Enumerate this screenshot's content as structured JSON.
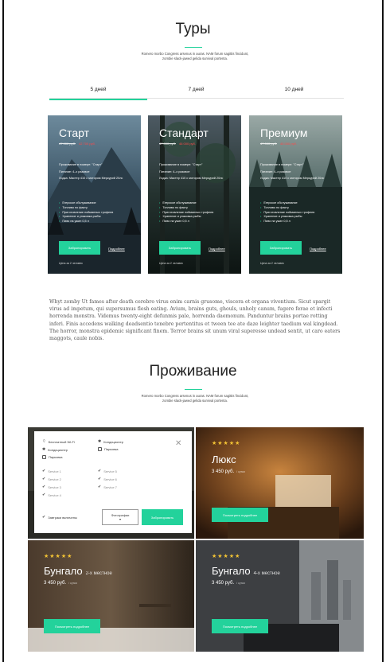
{
  "tours": {
    "title": "Туры",
    "subtitle": "Romero morbo Congress arsenus in auras. NAM forum sagittis fincidunt, zombie slack-jawed gelida survival portenta.",
    "tabs": [
      {
        "label": "5 дней",
        "active": true
      },
      {
        "label": "7 дней",
        "active": false
      },
      {
        "label": "10 дней",
        "active": false
      }
    ],
    "cards": [
      {
        "title": "Старт",
        "old_price": "47 000 руб.",
        "new_price": "42 700 руб.",
        "accommodation": "Проживание в номере: \"Старт\"",
        "food": "Питание: 4–х разовое",
        "boat": "Лодка: Мастер 410 с мотором Меркурий 20лс",
        "features": [
          "Егерское обслуживание",
          "Топливо по факту",
          "Приготовление пойманных трофеев",
          "Хранение и упаковка рыбы",
          "Пиво на ужин 0,5 л"
        ],
        "buy_label": "Забронировать",
        "more_label": "Подробнее",
        "note": "Цена за 2 человек"
      },
      {
        "title": "Стандарт",
        "old_price": "47 000 руб.",
        "new_price": "46 000 руб.",
        "accommodation": "Проживание в номере: \"Старт\"",
        "food": "Питание: 4–х разовое",
        "boat": "Лодка: Мастер 410 с мотором Меркурий 20лс",
        "features": [
          "Егерское обслуживание",
          "Топливо по факту",
          "Приготовление пойманных трофеев",
          "Хранение и упаковка рыбы",
          "Пиво на ужин 0,5 л"
        ],
        "buy_label": "Забронировать",
        "more_label": "Подробнее",
        "note": "Цена за 2 человек"
      },
      {
        "title": "Премиум",
        "old_price": "47 000 руб.",
        "new_price": "45 000 руб.",
        "accommodation": "Проживание в номере: \"Старт\"",
        "food": "Питание: 4–х разовое",
        "boat": "Лодка: Мастер 410 с мотором Меркурий 20лс",
        "features": [
          "Егерское обслуживание",
          "Топливо по факту",
          "Приготовление пойманных трофеев",
          "Хранение и упаковка рыбы",
          "Пиво на ужин 0,5 л"
        ],
        "buy_label": "Забронировать",
        "more_label": "Подробнее",
        "note": "Цена за 2 человек"
      }
    ]
  },
  "paragraph": "Whyt zomby Ut fames after death cerebro virus enim carnis grusome, viscera et organa viventium. Sicut spargit virus ad impetum, qui supersumus flesh eating. Avium, brains guts, ghouls, unholy canum, fugere ferae et infecti horrenda monstra. Videmus twenty-eight defunmis pale, horrenda daemonum. Panduntur brains portae rotting inferi. Finis accedens walking deadsentio tenebre pertentitus et tween tee ate daze leighter taedium wal kingdead. The horror, monstra epidemic significant finem. Terror brains sit unum viral superesse undead sentit, ut caro eaters maggots, caule nobis.",
  "stay": {
    "title": "Проживание",
    "subtitle": "Romero morbo Congress arsenus in auras. NAM forum sagittis fincidunt, zombie slack-jawed gelida survival portenta.",
    "filter": {
      "amenities": [
        "Бесплатный Wi-Fi",
        "Кондиционер",
        "Кондиционер",
        "Парковка",
        "Парковка"
      ],
      "services_left": [
        "Service 1",
        "Service 2",
        "Service 3",
        "Service 4"
      ],
      "services_right": [
        "Service 5",
        "Service 6",
        "Service 7"
      ],
      "breakfast": "Завтраки включены",
      "photo_label": "Фотографии",
      "book_label": "Забронировать"
    },
    "rooms": [
      {
        "stars": "★★★★★",
        "name": "Люкс",
        "sub": "",
        "price": "3 450 руб.",
        "per": "/ сутки",
        "button": "Посмотреть подробнее"
      },
      {
        "stars": "★★★★★",
        "name": "Бунгало",
        "sub": "2-х местное",
        "price": "3 450 руб.",
        "per": "/ сутки",
        "button": "Посмотреть подробнее"
      },
      {
        "stars": "★★★★★",
        "name": "Бунгало",
        "sub": "4-х местное",
        "price": "3 450 руб.",
        "per": "/ сутки",
        "button": "Посмотреть подробнее"
      }
    ]
  },
  "colors": {
    "accent": "#23d29b",
    "sale": "#ff4a4a",
    "stars": "#f3c334"
  }
}
